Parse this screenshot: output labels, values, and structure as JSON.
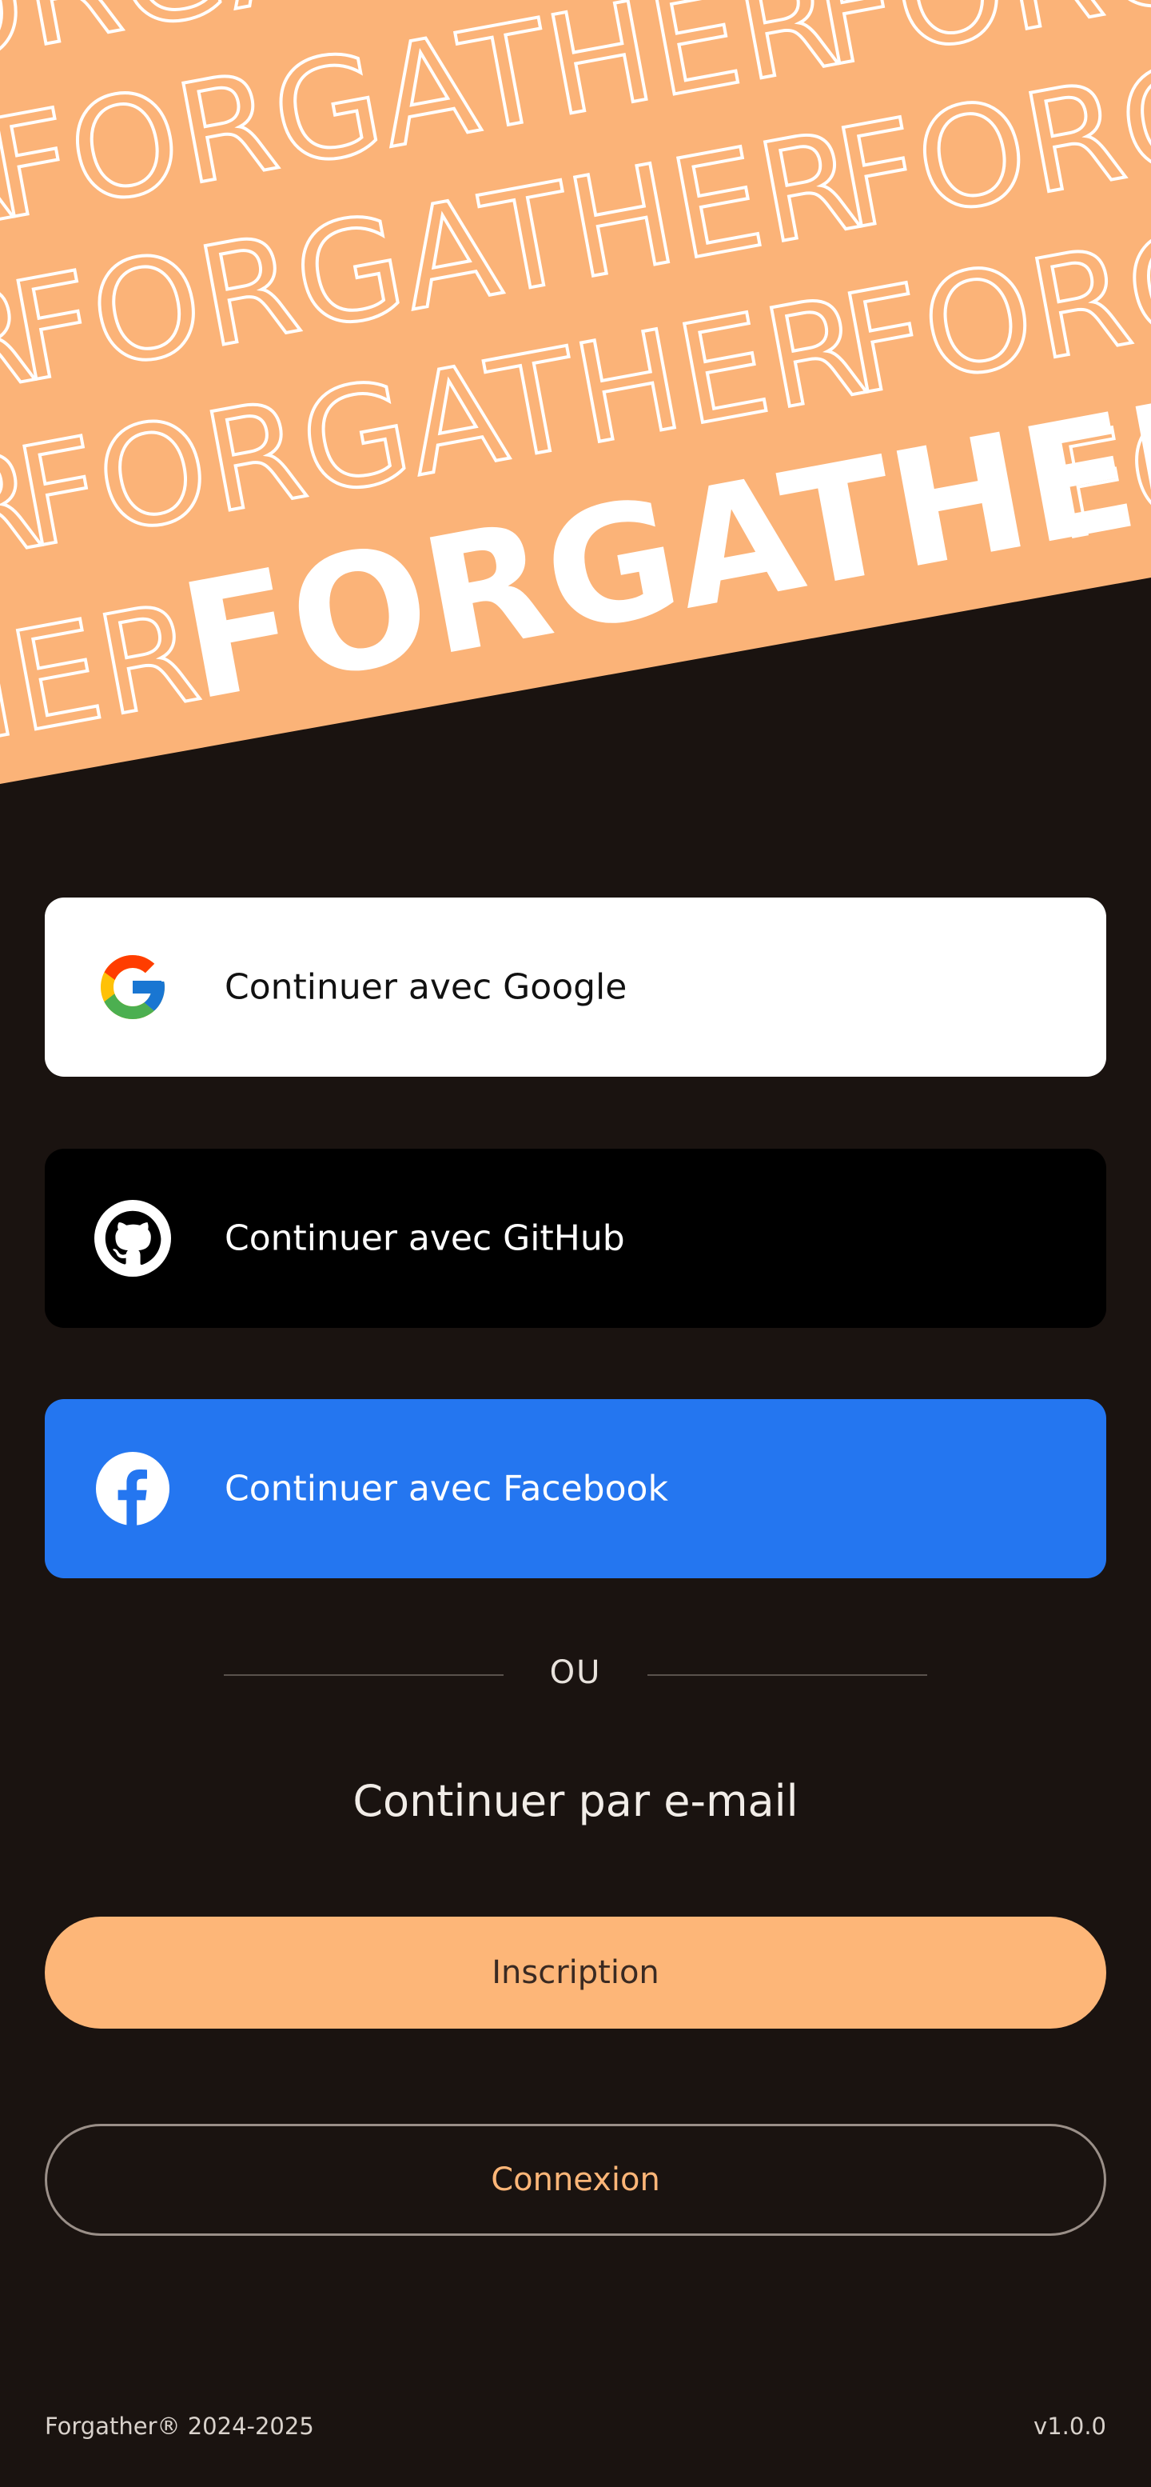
{
  "hero": {
    "brand_word": "FORGATHER",
    "background_color": "#fbb378",
    "word_color": "#ffffff"
  },
  "social": {
    "google": {
      "label": "Continuer avec Google",
      "icon": "google-logo-icon",
      "background": "#ffffff"
    },
    "github": {
      "label": "Continuer avec GitHub",
      "icon": "github-logo-icon",
      "background": "#000000"
    },
    "facebook": {
      "label": "Continuer avec Facebook",
      "icon": "facebook-logo-icon",
      "background": "#2476f0"
    }
  },
  "divider": {
    "text": "OU"
  },
  "email": {
    "title": "Continuer par e-mail",
    "signup_label": "Inscription",
    "login_label": "Connexion",
    "accent_color": "#fdb678"
  },
  "footer": {
    "copyright": "Forgather® 2024-2025",
    "version": "v1.0.0"
  }
}
